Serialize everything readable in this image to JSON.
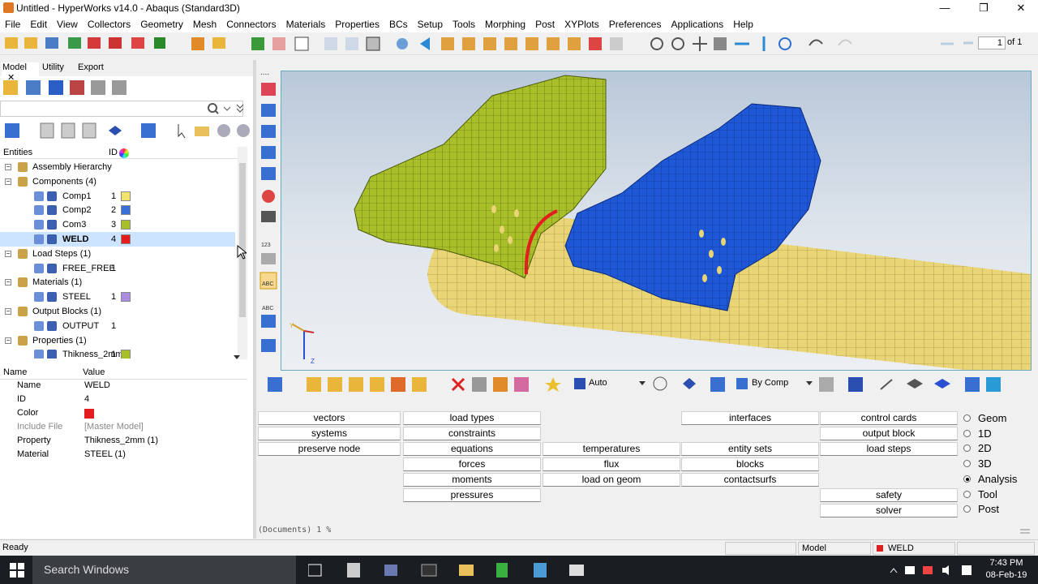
{
  "window": {
    "title": "Untitled - HyperWorks v14.0 - Abaqus (Standard3D)"
  },
  "menu": [
    "File",
    "Edit",
    "View",
    "Collectors",
    "Geometry",
    "Mesh",
    "Connectors",
    "Materials",
    "Properties",
    "BCs",
    "Setup",
    "Tools",
    "Morphing",
    "Post",
    "XYPlots",
    "Preferences",
    "Applications",
    "Help"
  ],
  "pager": {
    "page": "1",
    "of": "of 1"
  },
  "tabs": {
    "model": "Model",
    "utility": "Utility",
    "export": "Export"
  },
  "entities_header": {
    "entities": "Entities",
    "id": "ID"
  },
  "tree": [
    {
      "label": "Assembly Hierarchy",
      "id": "",
      "color": "",
      "level": 0,
      "icon": "assembly-icon"
    },
    {
      "label": "Components (4)",
      "id": "",
      "color": "",
      "level": 0,
      "icon": "components-icon"
    },
    {
      "label": "Comp1",
      "id": "1",
      "color": "#f2e36e",
      "level": 1,
      "icon": "component-icon"
    },
    {
      "label": "Comp2",
      "id": "2",
      "color": "#3a6fd8",
      "level": 1,
      "icon": "component-icon"
    },
    {
      "label": "Com3",
      "id": "3",
      "color": "#a9bf2a",
      "level": 1,
      "icon": "component-icon"
    },
    {
      "label": "WELD",
      "id": "4",
      "color": "#e31d1d",
      "level": 1,
      "icon": "component-icon",
      "selected": true
    },
    {
      "label": "Load Steps (1)",
      "id": "",
      "color": "",
      "level": 0,
      "icon": "loadsteps-icon"
    },
    {
      "label": "FREE_FREE",
      "id": "1",
      "color": "",
      "level": 1,
      "icon": "loadstep-icon"
    },
    {
      "label": "Materials (1)",
      "id": "",
      "color": "",
      "level": 0,
      "icon": "materials-icon"
    },
    {
      "label": "STEEL",
      "id": "1",
      "color": "#a98be0",
      "level": 1,
      "icon": "material-icon"
    },
    {
      "label": "Output Blocks (1)",
      "id": "",
      "color": "",
      "level": 0,
      "icon": "outputblocks-icon"
    },
    {
      "label": "OUTPUT",
      "id": "1",
      "color": "",
      "level": 1,
      "icon": "outputblock-icon"
    },
    {
      "label": "Properties (1)",
      "id": "",
      "color": "",
      "level": 0,
      "icon": "properties-icon"
    },
    {
      "label": "Thikness_2mm",
      "id": "1",
      "color": "#a9bf2a",
      "level": 1,
      "icon": "property-icon"
    }
  ],
  "props_header": {
    "name": "Name",
    "value": "Value"
  },
  "props": [
    {
      "k": "Name",
      "v": "WELD",
      "gray": false
    },
    {
      "k": "ID",
      "v": "4",
      "gray": false
    },
    {
      "k": "Color",
      "v": "",
      "gray": false,
      "swatch": "#e31d1d"
    },
    {
      "k": "Include File",
      "v": "[Master Model]",
      "gray": true
    },
    {
      "k": "Property",
      "v": "Thikness_2mm (1)",
      "gray": false
    },
    {
      "k": "Material",
      "v": "STEEL (1)",
      "gray": false
    }
  ],
  "viewport_toolbar": {
    "auto": "Auto",
    "bycomp": "By Comp"
  },
  "panel_buttons": {
    "col1": [
      "vectors",
      "systems",
      "preserve node"
    ],
    "col2": [
      "load types",
      "constraints",
      "equations",
      "forces",
      "moments",
      "pressures"
    ],
    "col3": [
      "temperatures",
      "flux",
      "load on geom"
    ],
    "col4": [
      "interfaces",
      "entity sets",
      "blocks",
      "contactsurfs"
    ],
    "col5": [
      "control cards",
      "output block",
      "load steps",
      "safety",
      "solver"
    ]
  },
  "radio": [
    {
      "label": "Geom",
      "on": false
    },
    {
      "label": "1D",
      "on": false
    },
    {
      "label": "2D",
      "on": false
    },
    {
      "label": "3D",
      "on": false
    },
    {
      "label": "Analysis",
      "on": true
    },
    {
      "label": "Tool",
      "on": false
    },
    {
      "label": "Post",
      "on": false
    }
  ],
  "cmdline": "(Documents) 1 %",
  "status": {
    "ready": "Ready",
    "model": "Model",
    "comp": "WELD"
  },
  "taskbar": {
    "search": "Search Windows",
    "time": "7:43 PM",
    "date": "08-Feb-19"
  },
  "colors": {
    "accent": "#2a6fd2",
    "weld": "#e31d1d",
    "yellow_comp": "#a9bf2a",
    "blue_comp": "#1f58d6",
    "tube": "#e9d575"
  }
}
